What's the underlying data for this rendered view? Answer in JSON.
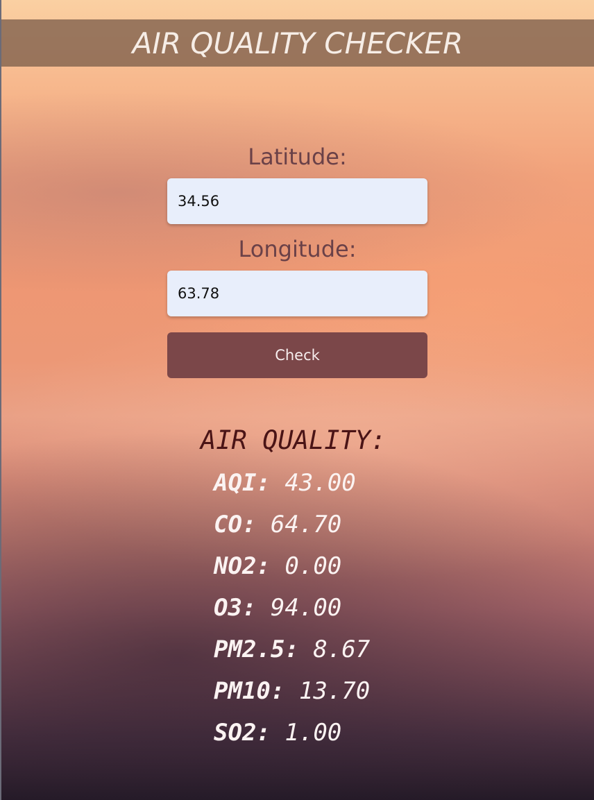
{
  "header": {
    "title": "AIR QUALITY CHECKER"
  },
  "form": {
    "latitude_label": "Latitude:",
    "latitude_value": "34.56",
    "longitude_label": "Longitude:",
    "longitude_value": "63.78",
    "check_label": "Check"
  },
  "results": {
    "title": "AIR QUALITY:",
    "items": [
      {
        "name": "AQI:",
        "value": "43.00"
      },
      {
        "name": "CO:",
        "value": "64.70"
      },
      {
        "name": "NO2:",
        "value": "0.00"
      },
      {
        "name": "O3:",
        "value": "94.00"
      },
      {
        "name": "PM2.5:",
        "value": "8.67"
      },
      {
        "name": "PM10:",
        "value": "13.70"
      },
      {
        "name": "SO2:",
        "value": "1.00"
      }
    ]
  },
  "colors": {
    "header_bar": "#7d5f4b",
    "button": "#7b4749",
    "input_background": "#e8eefb",
    "label_text": "#6a4148",
    "results_title": "#4a1416",
    "results_text": "#fbf3f2"
  }
}
